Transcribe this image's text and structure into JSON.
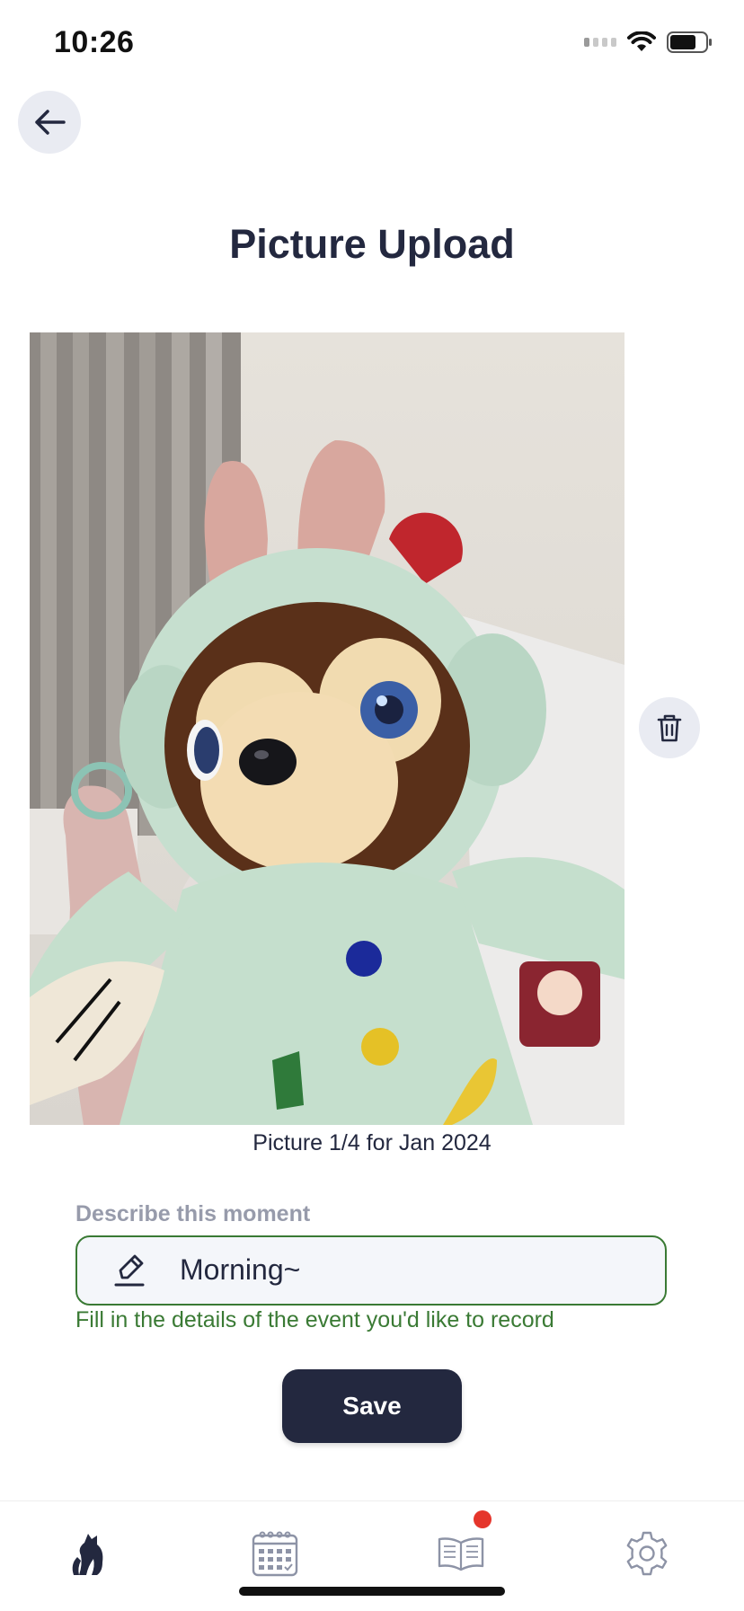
{
  "status": {
    "time": "10:26"
  },
  "header": {
    "title": "Picture Upload"
  },
  "photo": {
    "caption": "Picture 1/4 for Jan 2024"
  },
  "form": {
    "label": "Describe this moment",
    "value": "Morning~",
    "helper": "Fill in  the details of the event you'd like to record",
    "save_label": "Save"
  },
  "tabs": [
    {
      "icon": "pets-icon",
      "active": true
    },
    {
      "icon": "calendar-icon",
      "active": false
    },
    {
      "icon": "book-icon",
      "active": false,
      "badge": true
    },
    {
      "icon": "gear-icon",
      "active": false
    }
  ],
  "colors": {
    "primary": "#23283f",
    "accent_green": "#3a7a34",
    "badge_red": "#e5352b",
    "muted": "#979bab"
  }
}
